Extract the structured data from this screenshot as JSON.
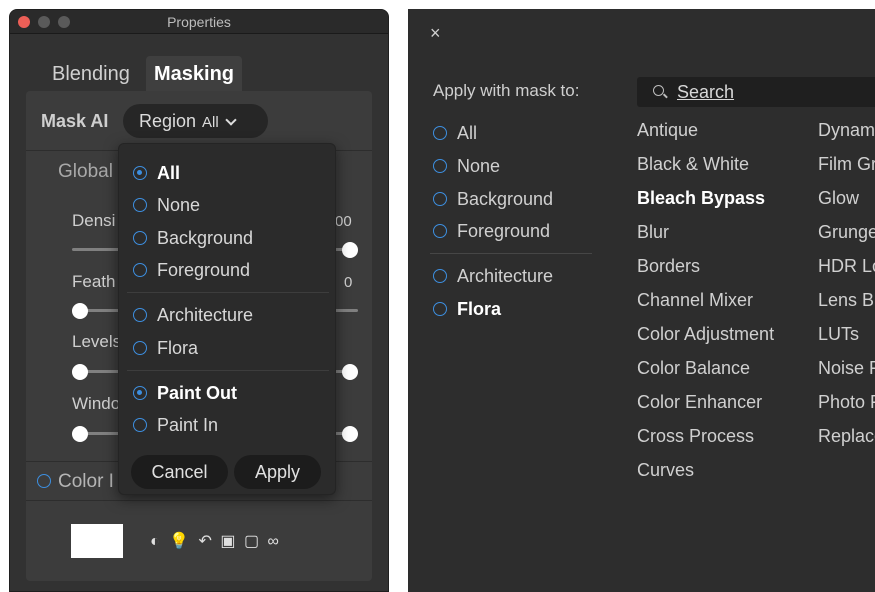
{
  "left_window": {
    "title": "Properties",
    "tabs": [
      {
        "label": "Blending"
      },
      {
        "label": "Masking"
      }
    ],
    "mask_ai": {
      "label": "Mask AI",
      "region_button": "Region",
      "region_value": "All"
    },
    "global_label": "Global",
    "sliders": [
      {
        "label": "Densi",
        "value_text": "00",
        "level": 1.0
      },
      {
        "label": "Feath",
        "value_text": "0",
        "level": 0.0
      },
      {
        "label": "Levels",
        "value_text": "",
        "level": 1.0
      },
      {
        "label": "Windo",
        "value_text": "",
        "level": 1.0
      }
    ],
    "color_label": "Color I",
    "dropdown": {
      "items": [
        {
          "label": "All",
          "checked": true
        },
        {
          "label": "None",
          "checked": false
        },
        {
          "label": "Background",
          "checked": false
        },
        {
          "label": "Foreground",
          "checked": false
        },
        {
          "label": "Architecture",
          "checked": false
        },
        {
          "label": "Flora",
          "checked": false
        },
        {
          "label": "Paint Out",
          "checked": true
        },
        {
          "label": "Paint In",
          "checked": false
        }
      ],
      "cancel": "Cancel",
      "apply": "Apply"
    },
    "icons": [
      "half-circle-icon",
      "lightbulb-icon",
      "undo-icon",
      "copy-mask-icon",
      "paste-mask-icon",
      "mask-view-icon"
    ]
  },
  "right_window": {
    "close": "×",
    "apply_with_mask_label": "Apply with mask to:",
    "search_placeholder": "Search",
    "mask_options": [
      {
        "label": "All",
        "bold": false
      },
      {
        "label": "None",
        "bold": false
      },
      {
        "label": "Background",
        "bold": false
      },
      {
        "label": "Foreground",
        "bold": false
      },
      {
        "label": "Architecture",
        "bold": false
      },
      {
        "label": "Flora",
        "bold": true
      }
    ],
    "filters_col1": [
      "Antique",
      "Black & White",
      "Bleach Bypass",
      "Blur",
      "Borders",
      "Channel Mixer",
      "Color Adjustment",
      "Color Balance",
      "Color Enhancer",
      "Cross Process",
      "Curves"
    ],
    "filters_col2": [
      "Dynam",
      "Film Gr",
      "Glow",
      "Grunge",
      "HDR Lo",
      "Lens B",
      "LUTs",
      "Noise F",
      "Photo F",
      "Replace"
    ],
    "bold_filter": "Bleach Bypass"
  }
}
